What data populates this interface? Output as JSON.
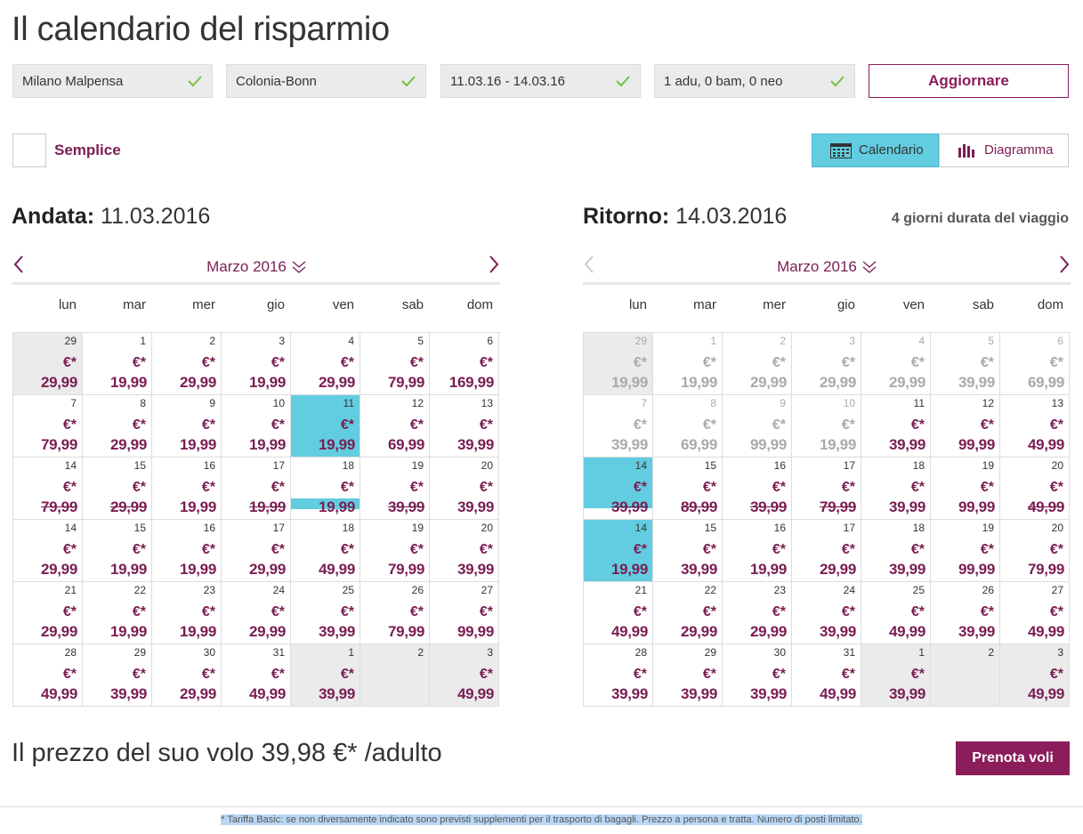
{
  "page": {
    "title": "Il calendario del risparmio"
  },
  "search": {
    "origin": "Milano Malpensa",
    "destination": "Colonia-Bonn",
    "dates": "11.03.16 - 14.03.16",
    "passengers": "1 adu, 0 bam, 0 neo",
    "update_label": "Aggiornare"
  },
  "options": {
    "simple_label": "Semplice"
  },
  "views": {
    "calendar_label": "Calendario",
    "diagram_label": "Diagramma",
    "active": "calendar"
  },
  "colors": {
    "accent": "#8b1d5a",
    "selected": "#62cde0",
    "disabled": "#aaaaaa"
  },
  "weekdays": [
    "lun",
    "mar",
    "mer",
    "gio",
    "ven",
    "sab",
    "dom"
  ],
  "outbound": {
    "label": "Andata:",
    "date": "11.03.2016",
    "month": "Marzo 2016",
    "weeks": [
      [
        {
          "d": "29",
          "c": "€*",
          "p": "29,99",
          "s": "grey"
        },
        {
          "d": "1",
          "c": "€*",
          "p": "19,99"
        },
        {
          "d": "2",
          "c": "€*",
          "p": "29,99"
        },
        {
          "d": "3",
          "c": "€*",
          "p": "19,99"
        },
        {
          "d": "4",
          "c": "€*",
          "p": "29,99"
        },
        {
          "d": "5",
          "c": "€*",
          "p": "79,99"
        },
        {
          "d": "6",
          "c": "€*",
          "p": "169,99"
        }
      ],
      [
        {
          "d": "7",
          "c": "€*",
          "p": "79,99"
        },
        {
          "d": "8",
          "c": "€*",
          "p": "29,99"
        },
        {
          "d": "9",
          "c": "€*",
          "p": "19,99"
        },
        {
          "d": "10",
          "c": "€*",
          "p": "19,99"
        },
        {
          "d": "11",
          "c": "€*",
          "p": "19,99",
          "s": "sel"
        },
        {
          "d": "12",
          "c": "€*",
          "p": "69,99"
        },
        {
          "d": "13",
          "c": "€*",
          "p": "39,99"
        }
      ],
      [
        {
          "d": "14",
          "c": "€*",
          "p": "79,99",
          "s": "strike"
        },
        {
          "d": "15",
          "c": "€*",
          "p": "29,99",
          "s": "strike"
        },
        {
          "d": "16",
          "c": "€*",
          "p": "19,99"
        },
        {
          "d": "17",
          "c": "€*",
          "p": "19,99",
          "s": "strike"
        },
        {
          "d": "18",
          "c": "€*",
          "p": "19,99",
          "s": "bar"
        },
        {
          "d": "19",
          "c": "€*",
          "p": "39,99",
          "s": "strike"
        },
        {
          "d": "20",
          "c": "€*",
          "p": "39,99"
        }
      ],
      [
        {
          "d": "14",
          "c": "€*",
          "p": "29,99"
        },
        {
          "d": "15",
          "c": "€*",
          "p": "19,99"
        },
        {
          "d": "16",
          "c": "€*",
          "p": "19,99"
        },
        {
          "d": "17",
          "c": "€*",
          "p": "29,99"
        },
        {
          "d": "18",
          "c": "€*",
          "p": "49,99"
        },
        {
          "d": "19",
          "c": "€*",
          "p": "79,99"
        },
        {
          "d": "20",
          "c": "€*",
          "p": "39,99"
        }
      ],
      [
        {
          "d": "21",
          "c": "€*",
          "p": "29,99"
        },
        {
          "d": "22",
          "c": "€*",
          "p": "19,99"
        },
        {
          "d": "23",
          "c": "€*",
          "p": "19,99"
        },
        {
          "d": "24",
          "c": "€*",
          "p": "29,99"
        },
        {
          "d": "25",
          "c": "€*",
          "p": "39,99"
        },
        {
          "d": "26",
          "c": "€*",
          "p": "79,99"
        },
        {
          "d": "27",
          "c": "€*",
          "p": "99,99"
        }
      ],
      [
        {
          "d": "28",
          "c": "€*",
          "p": "49,99"
        },
        {
          "d": "29",
          "c": "€*",
          "p": "39,99"
        },
        {
          "d": "30",
          "c": "€*",
          "p": "29,99"
        },
        {
          "d": "31",
          "c": "€*",
          "p": "49,99"
        },
        {
          "d": "1",
          "c": "€*",
          "p": "39,99",
          "s": "grey"
        },
        {
          "d": "2",
          "c": "",
          "p": "",
          "s": "grey"
        },
        {
          "d": "3",
          "c": "€*",
          "p": "49,99",
          "s": "grey"
        }
      ]
    ]
  },
  "return": {
    "label": "Ritorno:",
    "date": "14.03.2016",
    "duration": "4 giorni durata del viaggio",
    "month": "Marzo 2016",
    "weeks": [
      [
        {
          "d": "29",
          "c": "€*",
          "p": "19,99",
          "s": "grey dis"
        },
        {
          "d": "1",
          "c": "€*",
          "p": "19,99",
          "s": "dis"
        },
        {
          "d": "2",
          "c": "€*",
          "p": "29,99",
          "s": "dis"
        },
        {
          "d": "3",
          "c": "€*",
          "p": "29,99",
          "s": "dis"
        },
        {
          "d": "4",
          "c": "€*",
          "p": "29,99",
          "s": "dis"
        },
        {
          "d": "5",
          "c": "€*",
          "p": "39,99",
          "s": "dis"
        },
        {
          "d": "6",
          "c": "€*",
          "p": "69,99",
          "s": "dis"
        }
      ],
      [
        {
          "d": "7",
          "c": "€*",
          "p": "39,99",
          "s": "dis"
        },
        {
          "d": "8",
          "c": "€*",
          "p": "69,99",
          "s": "dis"
        },
        {
          "d": "9",
          "c": "€*",
          "p": "99,99",
          "s": "dis"
        },
        {
          "d": "10",
          "c": "€*",
          "p": "19,99",
          "s": "dis"
        },
        {
          "d": "11",
          "c": "€*",
          "p": "39,99"
        },
        {
          "d": "12",
          "c": "€*",
          "p": "99,99"
        },
        {
          "d": "13",
          "c": "€*",
          "p": "49,99"
        }
      ],
      [
        {
          "d": "14",
          "c": "€*",
          "p": "39,99",
          "s": "half-sel strike"
        },
        {
          "d": "15",
          "c": "€*",
          "p": "89,99",
          "s": "strike"
        },
        {
          "d": "16",
          "c": "€*",
          "p": "39,99",
          "s": "strike"
        },
        {
          "d": "17",
          "c": "€*",
          "p": "79,99",
          "s": "strike"
        },
        {
          "d": "18",
          "c": "€*",
          "p": "39,99"
        },
        {
          "d": "19",
          "c": "€*",
          "p": "99,99"
        },
        {
          "d": "20",
          "c": "€*",
          "p": "49,99",
          "s": "strike"
        }
      ],
      [
        {
          "d": "14",
          "c": "€*",
          "p": "19,99",
          "s": "sel"
        },
        {
          "d": "15",
          "c": "€*",
          "p": "39,99"
        },
        {
          "d": "16",
          "c": "€*",
          "p": "19,99"
        },
        {
          "d": "17",
          "c": "€*",
          "p": "29,99"
        },
        {
          "d": "18",
          "c": "€*",
          "p": "39,99"
        },
        {
          "d": "19",
          "c": "€*",
          "p": "99,99"
        },
        {
          "d": "20",
          "c": "€*",
          "p": "79,99"
        }
      ],
      [
        {
          "d": "21",
          "c": "€*",
          "p": "49,99"
        },
        {
          "d": "22",
          "c": "€*",
          "p": "29,99"
        },
        {
          "d": "23",
          "c": "€*",
          "p": "29,99"
        },
        {
          "d": "24",
          "c": "€*",
          "p": "39,99"
        },
        {
          "d": "25",
          "c": "€*",
          "p": "49,99"
        },
        {
          "d": "26",
          "c": "€*",
          "p": "39,99"
        },
        {
          "d": "27",
          "c": "€*",
          "p": "49,99"
        }
      ],
      [
        {
          "d": "28",
          "c": "€*",
          "p": "39,99"
        },
        {
          "d": "29",
          "c": "€*",
          "p": "39,99"
        },
        {
          "d": "30",
          "c": "€*",
          "p": "39,99"
        },
        {
          "d": "31",
          "c": "€*",
          "p": "49,99"
        },
        {
          "d": "1",
          "c": "€*",
          "p": "39,99",
          "s": "grey"
        },
        {
          "d": "2",
          "c": "",
          "p": "",
          "s": "grey"
        },
        {
          "d": "3",
          "c": "€*",
          "p": "49,99",
          "s": "grey"
        }
      ]
    ]
  },
  "summary": {
    "price_text": "Il prezzo del suo volo 39,98 €* /adulto",
    "book_label": "Prenota voli"
  },
  "footnote": "* Tariffa Basic: se non diversamente indicato sono previsti supplementi per il trasporto di bagagli. Prezzo a persona e tratta. Numero di posti limitato."
}
